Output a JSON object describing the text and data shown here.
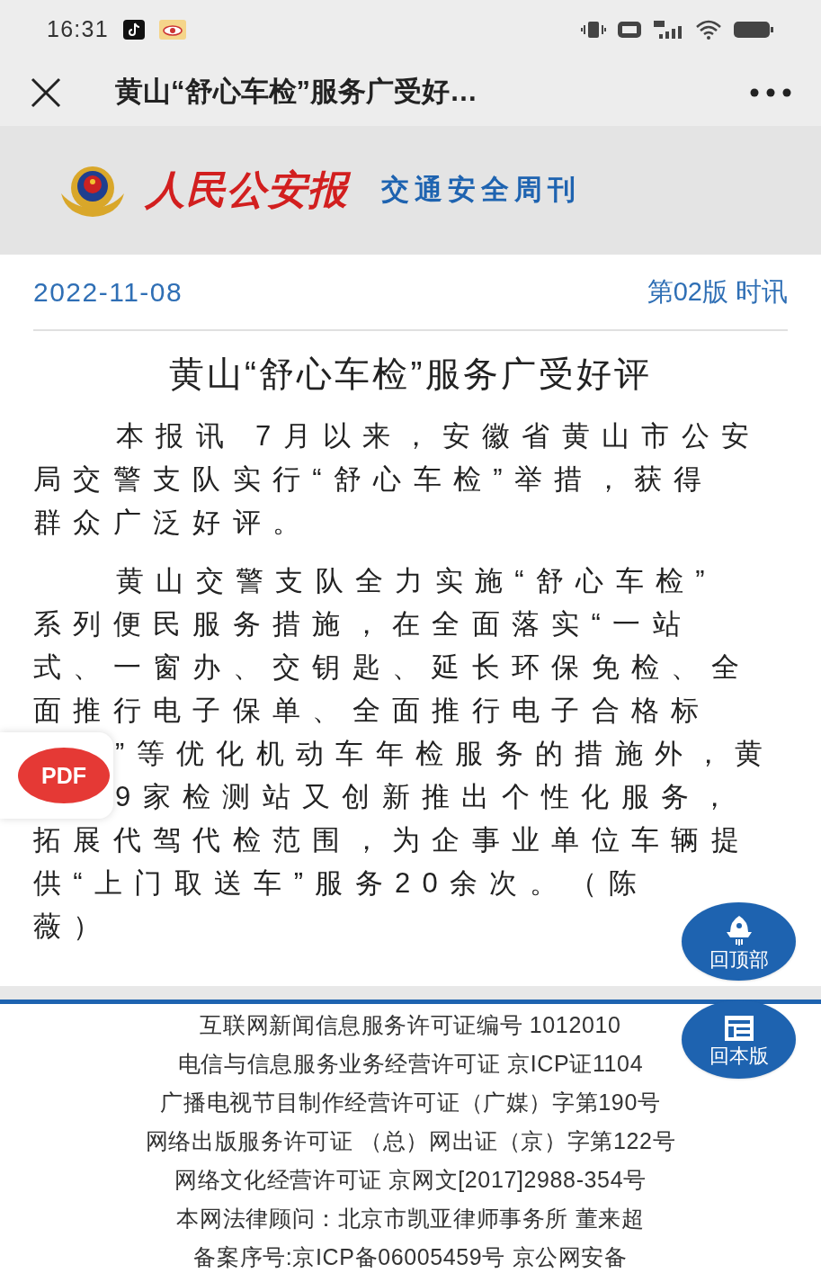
{
  "status_bar": {
    "time": "16:31"
  },
  "nav": {
    "title": "黄山“舒心车检”服务广受好…"
  },
  "banner": {
    "masthead": "人民公安报",
    "section": "交通安全周刊"
  },
  "article": {
    "date": "2022-11-08",
    "edition": "第02版 时讯",
    "title": "黄山“舒心车检”服务广受好评",
    "paragraphs": [
      [
        "本报讯 7月以来，安徽省黄山市公安",
        "局交警支队实行“舒心车检”举措，获得",
        "群众广泛好评。"
      ],
      [
        "黄山交警支队全力实施“舒心车检”",
        "系列便民服务措施，在全面落实“一站",
        "式、一窗办、交钥匙、延长环保免检、全",
        "面推行电子保单、全面推行电子合格标",
        "”等优化机动车年检服务的措施外，黄",
        "9家检测站又创新推出个性化服务，",
        "拓展代驾代检范围，为企事业单位车辆提",
        "供“上门取送车”服务20余次。（陈",
        "薇）"
      ]
    ]
  },
  "pdf_button": {
    "label": "PDF"
  },
  "float_buttons": [
    {
      "kind": "top",
      "label": "回顶部"
    },
    {
      "kind": "edition",
      "label": "回本版"
    }
  ],
  "footer": [
    "互联网新闻信息服务许可证编号 1012010",
    "电信与信息服务业务经营许可证 京ICP证1104",
    "广播电视节目制作经营许可证（广媒）字第190号",
    "网络出版服务许可证 （总）网出证（京）字第122号",
    "网络文化经营许可证 京网文[2017]2988-354号",
    "本网法律顾问：北京市凯亚律师事务所 董来超",
    "备案序号:京ICP备06005459号 京公网安备"
  ]
}
